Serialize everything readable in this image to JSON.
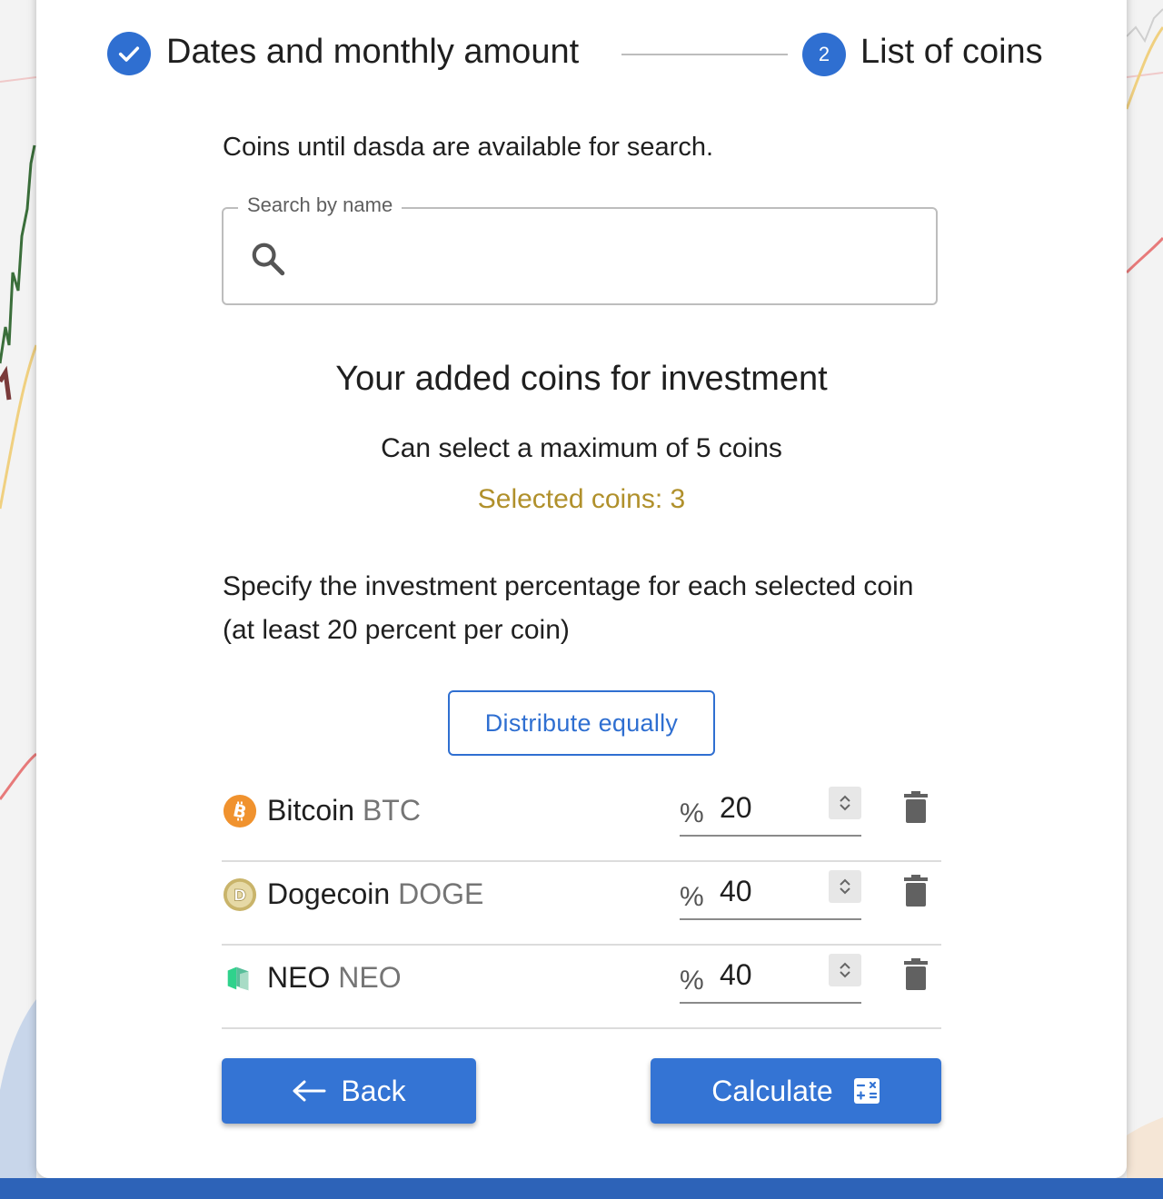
{
  "stepper": {
    "step1": {
      "label": "Dates and monthly amount",
      "state": "completed",
      "icon": "check-icon"
    },
    "step2": {
      "number": "2",
      "label": "List of coins",
      "state": "active"
    }
  },
  "info_text": "Coins until dasda are available for search.",
  "search": {
    "legend": "Search by name",
    "value": "",
    "icon": "search-icon"
  },
  "section_title": "Your added coins for investment",
  "max_text": "Can select a maximum of 5 coins",
  "selected_text": "Selected coins: 3",
  "spec_text": "Specify the investment percentage for each selected coin (at least 20 percent per coin)",
  "distribute_label": "Distribute equally",
  "coins": [
    {
      "name": "Bitcoin",
      "symbol": "BTC",
      "percent_sign": "%",
      "percent": "20",
      "icon": "bitcoin-icon"
    },
    {
      "name": "Dogecoin",
      "symbol": "DOGE",
      "percent_sign": "%",
      "percent": "40",
      "icon": "dogecoin-icon"
    },
    {
      "name": "NEO",
      "symbol": "NEO",
      "percent_sign": "%",
      "percent": "40",
      "icon": "neo-icon"
    }
  ],
  "buttons": {
    "back_label": "Back",
    "back_icon": "arrow-left-icon",
    "calculate_label": "Calculate",
    "calculate_icon": "calculator-icon"
  },
  "colors": {
    "primary": "#2f6fd1",
    "selected_text": "#b0902b",
    "bottom_bar": "#2d63b8"
  }
}
